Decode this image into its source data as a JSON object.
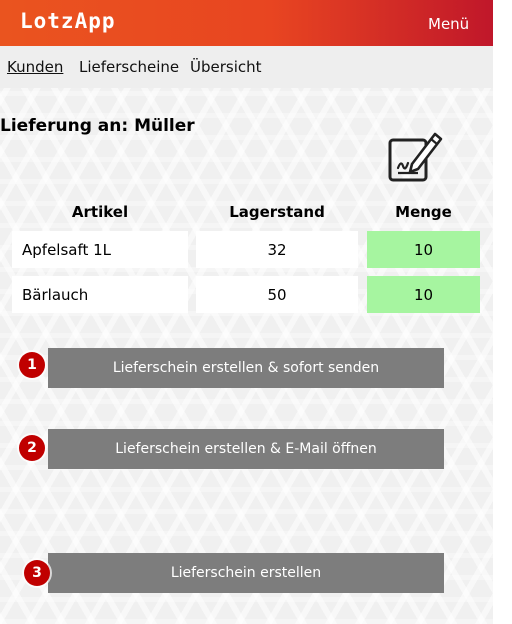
{
  "app": {
    "title": "LotzApp",
    "menu_label": "Menü"
  },
  "nav": {
    "items": [
      "Kunden",
      "Lieferscheine",
      "Übersicht"
    ],
    "active": "Kunden"
  },
  "delivery": {
    "title": "Lieferung an: Müller"
  },
  "table": {
    "headers": [
      "Artikel",
      "Lagerstand",
      "Menge"
    ],
    "rows": [
      {
        "artikel": "Apfelsaft 1L",
        "lagerstand": "32",
        "menge": "10"
      },
      {
        "artikel": "Bärlauch",
        "lagerstand": "50",
        "menge": "10"
      }
    ]
  },
  "actions": [
    {
      "badge": "1",
      "label": "Lieferschein erstellen & sofort senden"
    },
    {
      "badge": "2",
      "label": "Lieferschein erstellen & E-Mail öffnen"
    },
    {
      "badge": "3",
      "label": "Lieferschein erstellen"
    }
  ],
  "icons": {
    "signature": "signature-pen-icon"
  },
  "colors": {
    "header_start": "#ea541f",
    "header_end": "#c0172a",
    "quantity_bg": "#a6f5a0",
    "button_bg": "#7d7d7d",
    "badge_bg": "#c00000"
  }
}
